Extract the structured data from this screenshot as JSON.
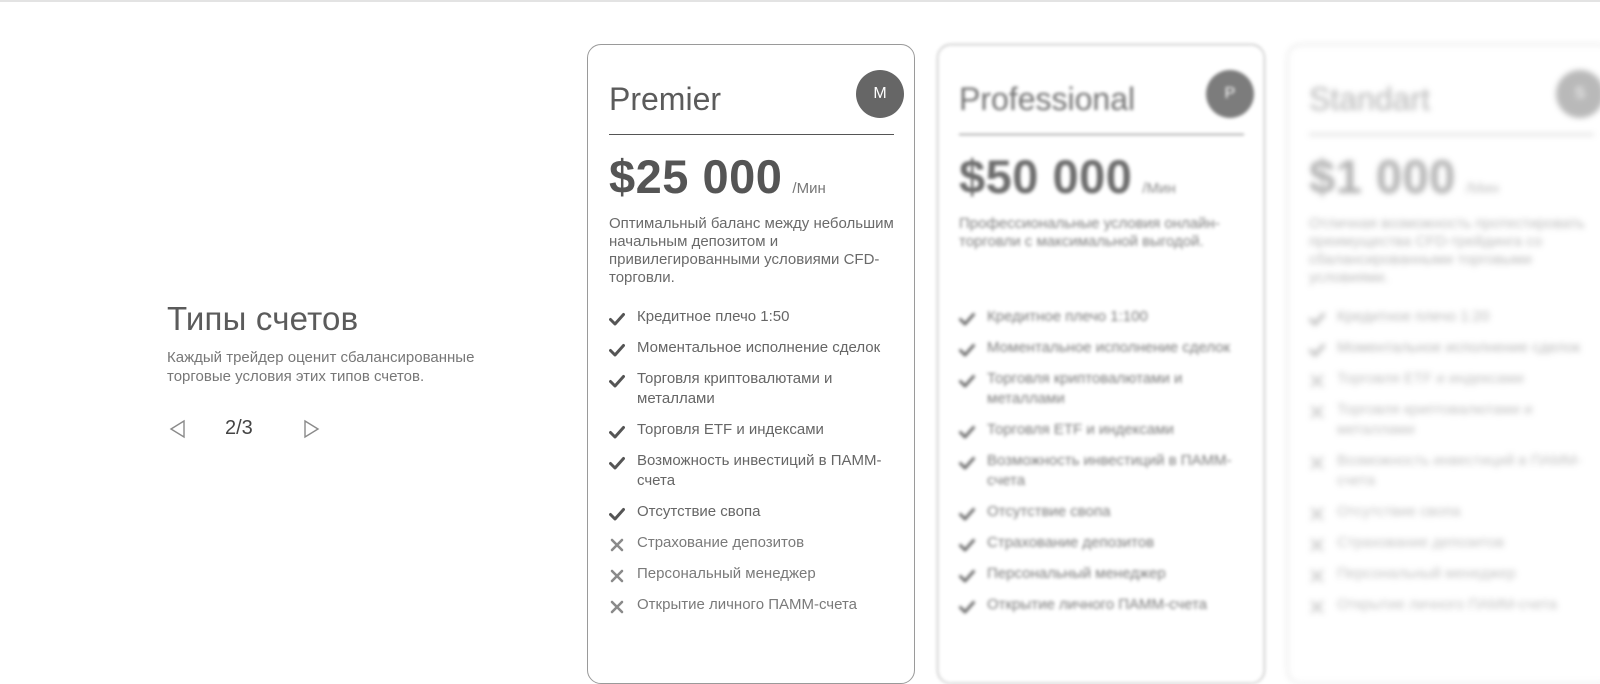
{
  "intro": {
    "title": "Типы счетов",
    "subtitle": "Каждый трейдер оценит сбалансированные торговые условия этих типов счетов.",
    "pager": {
      "current": "2/3"
    }
  },
  "cards": [
    {
      "name": "Premier",
      "badge": "M",
      "price": "$25 000",
      "per": "/Мин",
      "description": "Оптимальный баланс между небольшим начальным депозитом и привилегированными условиями CFD-торговли.",
      "features": [
        {
          "text": "Кредитное плечо 1:50",
          "included": true
        },
        {
          "text": "Моментальное исполнение сделок",
          "included": true
        },
        {
          "text": "Торговля криптовалютами и металлами",
          "included": true
        },
        {
          "text": "Торговля ETF и индексами",
          "included": true
        },
        {
          "text": "Возможность инвестиций в ПАММ-счета",
          "included": true
        },
        {
          "text": "Отсутствие свопа",
          "included": true
        },
        {
          "text": "Страхование депозитов",
          "included": false
        },
        {
          "text": "Персональный менеджер",
          "included": false
        },
        {
          "text": "Открытие личного ПАММ-счета",
          "included": false
        }
      ]
    },
    {
      "name": "Professional",
      "badge": "P",
      "price": "$50 000",
      "per": "/Мин",
      "description": "Профессиональные условия онлайн-торговли с максимальной выгодой.",
      "features": [
        {
          "text": "Кредитное плечо 1:100",
          "included": true
        },
        {
          "text": "Моментальное исполнение сделок",
          "included": true
        },
        {
          "text": "Торговля криптовалютами и металлами",
          "included": true
        },
        {
          "text": "Торговля ETF и индексами",
          "included": true
        },
        {
          "text": "Возможность инвестиций в ПАММ-счета",
          "included": true
        },
        {
          "text": "Отсутствие свопа",
          "included": true
        },
        {
          "text": "Страхование депозитов",
          "included": true
        },
        {
          "text": "Персональный менеджер",
          "included": true
        },
        {
          "text": "Открытие личного ПАММ-счета",
          "included": true
        }
      ]
    },
    {
      "name": "Standart",
      "badge": "S",
      "price": "$1 000",
      "per": "/Мин",
      "description": "Отличная возможность протестировать преимущества CFD-трейдинга со сбалансированными торговыми условиями.",
      "features": [
        {
          "text": "Кредитное плечо 1:20",
          "included": true
        },
        {
          "text": "Моментальное исполнение сделок",
          "included": true
        },
        {
          "text": "Торговля ETF и индексами",
          "included": false
        },
        {
          "text": "Торговля криптовалютами и металлами",
          "included": false
        },
        {
          "text": "Возможность инвестиций в ПАММ-счета",
          "included": false
        },
        {
          "text": "Отсутствие свопа",
          "included": false
        },
        {
          "text": "Страхование депозитов",
          "included": false
        },
        {
          "text": "Персональный менеджер",
          "included": false
        },
        {
          "text": "Открытие личного ПАММ-счета",
          "included": false
        }
      ]
    }
  ]
}
